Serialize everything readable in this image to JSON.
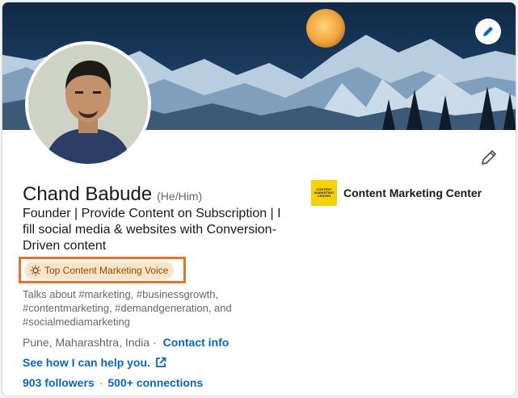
{
  "profile": {
    "name": "Chand Babude",
    "pronouns": "(He/Him)",
    "headline": "Founder | Provide Content on Subscription | I fill social media & websites with Conversion-Driven content",
    "badge": {
      "label": "Top Content Marketing Voice",
      "icon": "bulb-icon"
    },
    "talks_about": "Talks about #marketing, #businessgrowth, #contentmarketing, #demandgeneration, and #socialmediamarketing",
    "location": "Pune, Maharashtra, India",
    "contact_link": "Contact info",
    "help_link": "See how I can help you.",
    "followers": "903 followers",
    "connections": "500+ connections"
  },
  "company": {
    "name": "Content Marketing Center",
    "logo_text": "CONTENT MARKETING CENTER"
  },
  "colors": {
    "accent": "#0a66c2",
    "badge_bg": "#fce4c7",
    "highlight_border": "#e8712b",
    "logo_bg": "#f6d200"
  }
}
